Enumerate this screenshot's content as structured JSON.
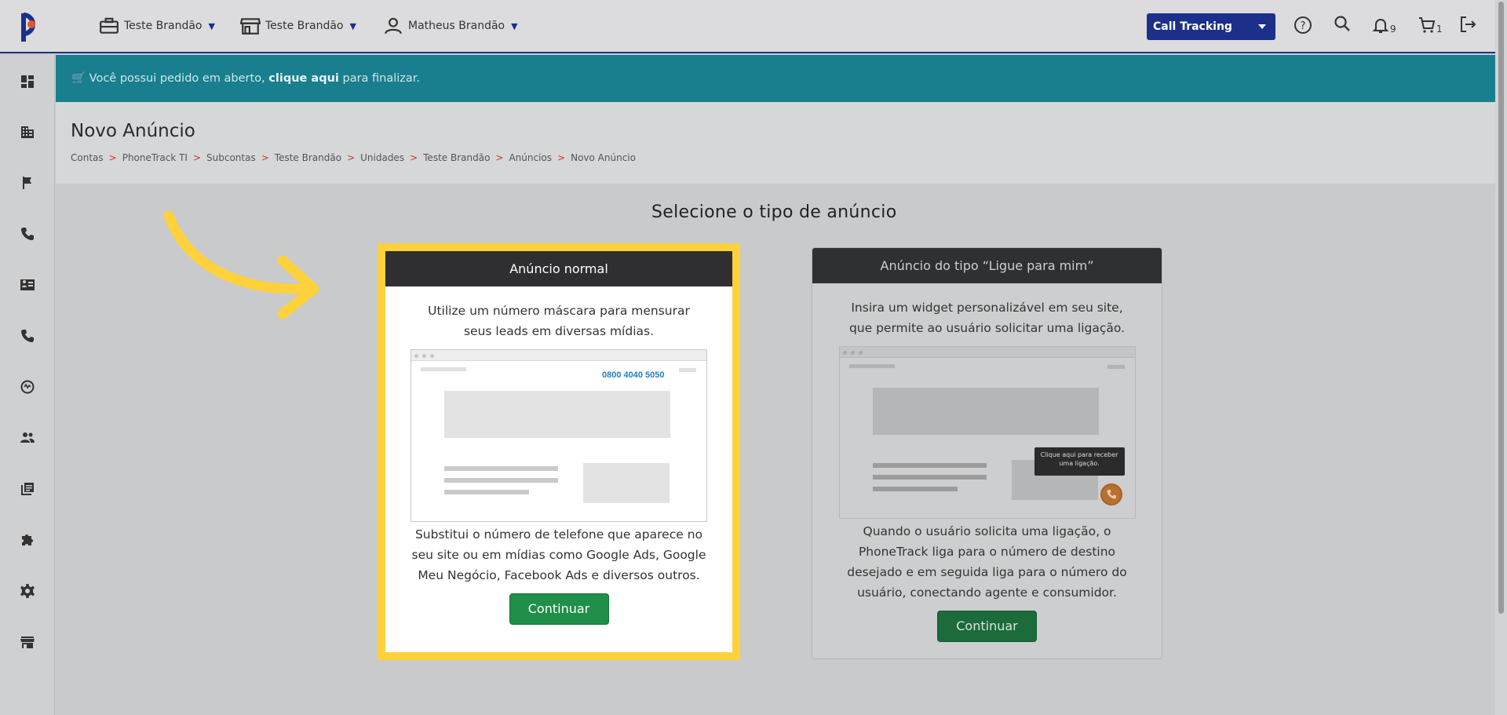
{
  "header": {
    "menu": [
      {
        "label": "Teste Brandão",
        "icon": "briefcase-icon"
      },
      {
        "label": "Teste Brandão",
        "icon": "store-icon"
      },
      {
        "label": "Matheus Brandão",
        "icon": "user-icon"
      }
    ],
    "product_select": "Call Tracking",
    "notifications_count": "9",
    "cart_count": "1"
  },
  "sidebar": {
    "items": [
      "dashboard-icon",
      "building-icon",
      "flag-icon",
      "phone-icon",
      "contact-card-icon",
      "phone-call-icon",
      "speed-icon",
      "people-icon",
      "library-icon",
      "puzzle-icon",
      "settings-icon",
      "storefront-icon"
    ]
  },
  "banner": {
    "prefix": "Você possui pedido em aberto,",
    "link": "clique aqui",
    "suffix": "para finalizar."
  },
  "page": {
    "title": "Novo Anúncio",
    "breadcrumb": [
      "Contas",
      "PhoneTrack TI",
      "Subcontas",
      "Teste Brandão",
      "Unidades",
      "Teste Brandão",
      "Anúncios",
      "Novo Anúncio"
    ],
    "breadcrumb_sep": ">",
    "section_title": "Selecione o tipo de anúncio"
  },
  "cards": {
    "normal": {
      "title": "Anúncio normal",
      "desc1": "Utilize um número máscara para mensurar seus leads em diversas mídias.",
      "mock_phone": "0800 4040 5050",
      "desc2": "Substitui o número de telefone que aparece no seu site ou em mídias como Google Ads, Google Meu Negócio, Facebook Ads e diversos outros.",
      "button": "Continuar"
    },
    "callme": {
      "title": "Anúncio do tipo “Ligue para mim”",
      "desc1": "Insira um widget personalizável em seu site, que permite ao usuário solicitar uma ligação.",
      "tooltip": "Clique aqui para receber uma ligação.",
      "desc2": "Quando o usuário solicita uma ligação, o PhoneTrack liga para o número de destino desejado e em seguida liga para o número do usuário, conectando agente e consumidor.",
      "button": "Continuar"
    }
  },
  "colors": {
    "brand_blue": "#1c2f8a",
    "banner_teal": "#197f8e",
    "highlight_yellow": "#ffd13b",
    "button_green": "#1f8f49"
  }
}
